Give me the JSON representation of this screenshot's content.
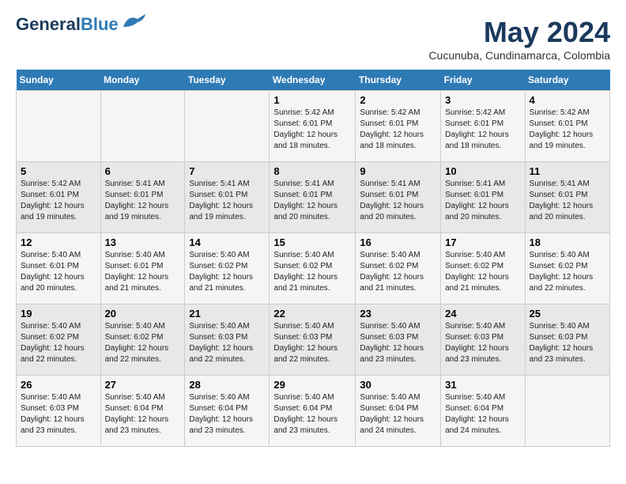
{
  "logo": {
    "general": "General",
    "blue": "Blue"
  },
  "title": "May 2024",
  "location": "Cucunuba, Cundinamarca, Colombia",
  "days_of_week": [
    "Sunday",
    "Monday",
    "Tuesday",
    "Wednesday",
    "Thursday",
    "Friday",
    "Saturday"
  ],
  "weeks": [
    [
      {
        "day": "",
        "info": ""
      },
      {
        "day": "",
        "info": ""
      },
      {
        "day": "",
        "info": ""
      },
      {
        "day": "1",
        "info": "Sunrise: 5:42 AM\nSunset: 6:01 PM\nDaylight: 12 hours\nand 18 minutes."
      },
      {
        "day": "2",
        "info": "Sunrise: 5:42 AM\nSunset: 6:01 PM\nDaylight: 12 hours\nand 18 minutes."
      },
      {
        "day": "3",
        "info": "Sunrise: 5:42 AM\nSunset: 6:01 PM\nDaylight: 12 hours\nand 18 minutes."
      },
      {
        "day": "4",
        "info": "Sunrise: 5:42 AM\nSunset: 6:01 PM\nDaylight: 12 hours\nand 19 minutes."
      }
    ],
    [
      {
        "day": "5",
        "info": "Sunrise: 5:42 AM\nSunset: 6:01 PM\nDaylight: 12 hours\nand 19 minutes."
      },
      {
        "day": "6",
        "info": "Sunrise: 5:41 AM\nSunset: 6:01 PM\nDaylight: 12 hours\nand 19 minutes."
      },
      {
        "day": "7",
        "info": "Sunrise: 5:41 AM\nSunset: 6:01 PM\nDaylight: 12 hours\nand 19 minutes."
      },
      {
        "day": "8",
        "info": "Sunrise: 5:41 AM\nSunset: 6:01 PM\nDaylight: 12 hours\nand 20 minutes."
      },
      {
        "day": "9",
        "info": "Sunrise: 5:41 AM\nSunset: 6:01 PM\nDaylight: 12 hours\nand 20 minutes."
      },
      {
        "day": "10",
        "info": "Sunrise: 5:41 AM\nSunset: 6:01 PM\nDaylight: 12 hours\nand 20 minutes."
      },
      {
        "day": "11",
        "info": "Sunrise: 5:41 AM\nSunset: 6:01 PM\nDaylight: 12 hours\nand 20 minutes."
      }
    ],
    [
      {
        "day": "12",
        "info": "Sunrise: 5:40 AM\nSunset: 6:01 PM\nDaylight: 12 hours\nand 20 minutes."
      },
      {
        "day": "13",
        "info": "Sunrise: 5:40 AM\nSunset: 6:01 PM\nDaylight: 12 hours\nand 21 minutes."
      },
      {
        "day": "14",
        "info": "Sunrise: 5:40 AM\nSunset: 6:02 PM\nDaylight: 12 hours\nand 21 minutes."
      },
      {
        "day": "15",
        "info": "Sunrise: 5:40 AM\nSunset: 6:02 PM\nDaylight: 12 hours\nand 21 minutes."
      },
      {
        "day": "16",
        "info": "Sunrise: 5:40 AM\nSunset: 6:02 PM\nDaylight: 12 hours\nand 21 minutes."
      },
      {
        "day": "17",
        "info": "Sunrise: 5:40 AM\nSunset: 6:02 PM\nDaylight: 12 hours\nand 21 minutes."
      },
      {
        "day": "18",
        "info": "Sunrise: 5:40 AM\nSunset: 6:02 PM\nDaylight: 12 hours\nand 22 minutes."
      }
    ],
    [
      {
        "day": "19",
        "info": "Sunrise: 5:40 AM\nSunset: 6:02 PM\nDaylight: 12 hours\nand 22 minutes."
      },
      {
        "day": "20",
        "info": "Sunrise: 5:40 AM\nSunset: 6:02 PM\nDaylight: 12 hours\nand 22 minutes."
      },
      {
        "day": "21",
        "info": "Sunrise: 5:40 AM\nSunset: 6:03 PM\nDaylight: 12 hours\nand 22 minutes."
      },
      {
        "day": "22",
        "info": "Sunrise: 5:40 AM\nSunset: 6:03 PM\nDaylight: 12 hours\nand 22 minutes."
      },
      {
        "day": "23",
        "info": "Sunrise: 5:40 AM\nSunset: 6:03 PM\nDaylight: 12 hours\nand 23 minutes."
      },
      {
        "day": "24",
        "info": "Sunrise: 5:40 AM\nSunset: 6:03 PM\nDaylight: 12 hours\nand 23 minutes."
      },
      {
        "day": "25",
        "info": "Sunrise: 5:40 AM\nSunset: 6:03 PM\nDaylight: 12 hours\nand 23 minutes."
      }
    ],
    [
      {
        "day": "26",
        "info": "Sunrise: 5:40 AM\nSunset: 6:03 PM\nDaylight: 12 hours\nand 23 minutes."
      },
      {
        "day": "27",
        "info": "Sunrise: 5:40 AM\nSunset: 6:04 PM\nDaylight: 12 hours\nand 23 minutes."
      },
      {
        "day": "28",
        "info": "Sunrise: 5:40 AM\nSunset: 6:04 PM\nDaylight: 12 hours\nand 23 minutes."
      },
      {
        "day": "29",
        "info": "Sunrise: 5:40 AM\nSunset: 6:04 PM\nDaylight: 12 hours\nand 23 minutes."
      },
      {
        "day": "30",
        "info": "Sunrise: 5:40 AM\nSunset: 6:04 PM\nDaylight: 12 hours\nand 24 minutes."
      },
      {
        "day": "31",
        "info": "Sunrise: 5:40 AM\nSunset: 6:04 PM\nDaylight: 12 hours\nand 24 minutes."
      },
      {
        "day": "",
        "info": ""
      }
    ]
  ]
}
